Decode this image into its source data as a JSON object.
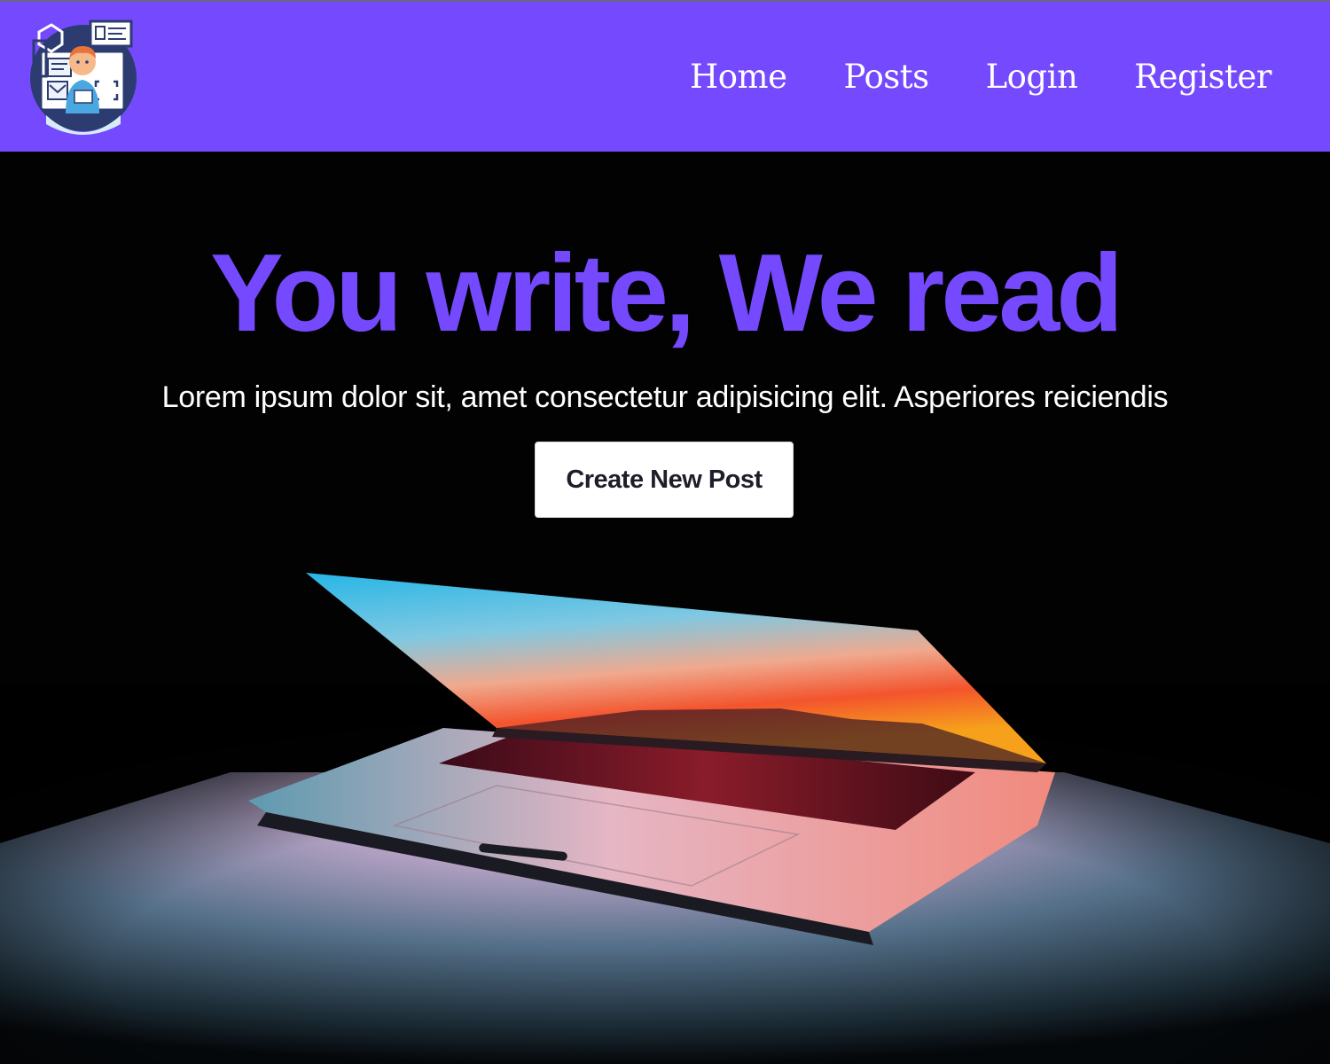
{
  "navbar": {
    "background_color": "#7549fd",
    "logo_icon": "developer-avatar-icon",
    "links": [
      {
        "label": "Home"
      },
      {
        "label": "Posts"
      },
      {
        "label": "Login"
      },
      {
        "label": "Register"
      }
    ]
  },
  "hero": {
    "title": "You write, We read",
    "title_color": "#7549fd",
    "subtitle": "Lorem ipsum dolor sit, amet consectetur adipisicing elit. Asperiores reiciendis",
    "cta_label": "Create New Post",
    "background_image": "glowing-laptop-image"
  }
}
